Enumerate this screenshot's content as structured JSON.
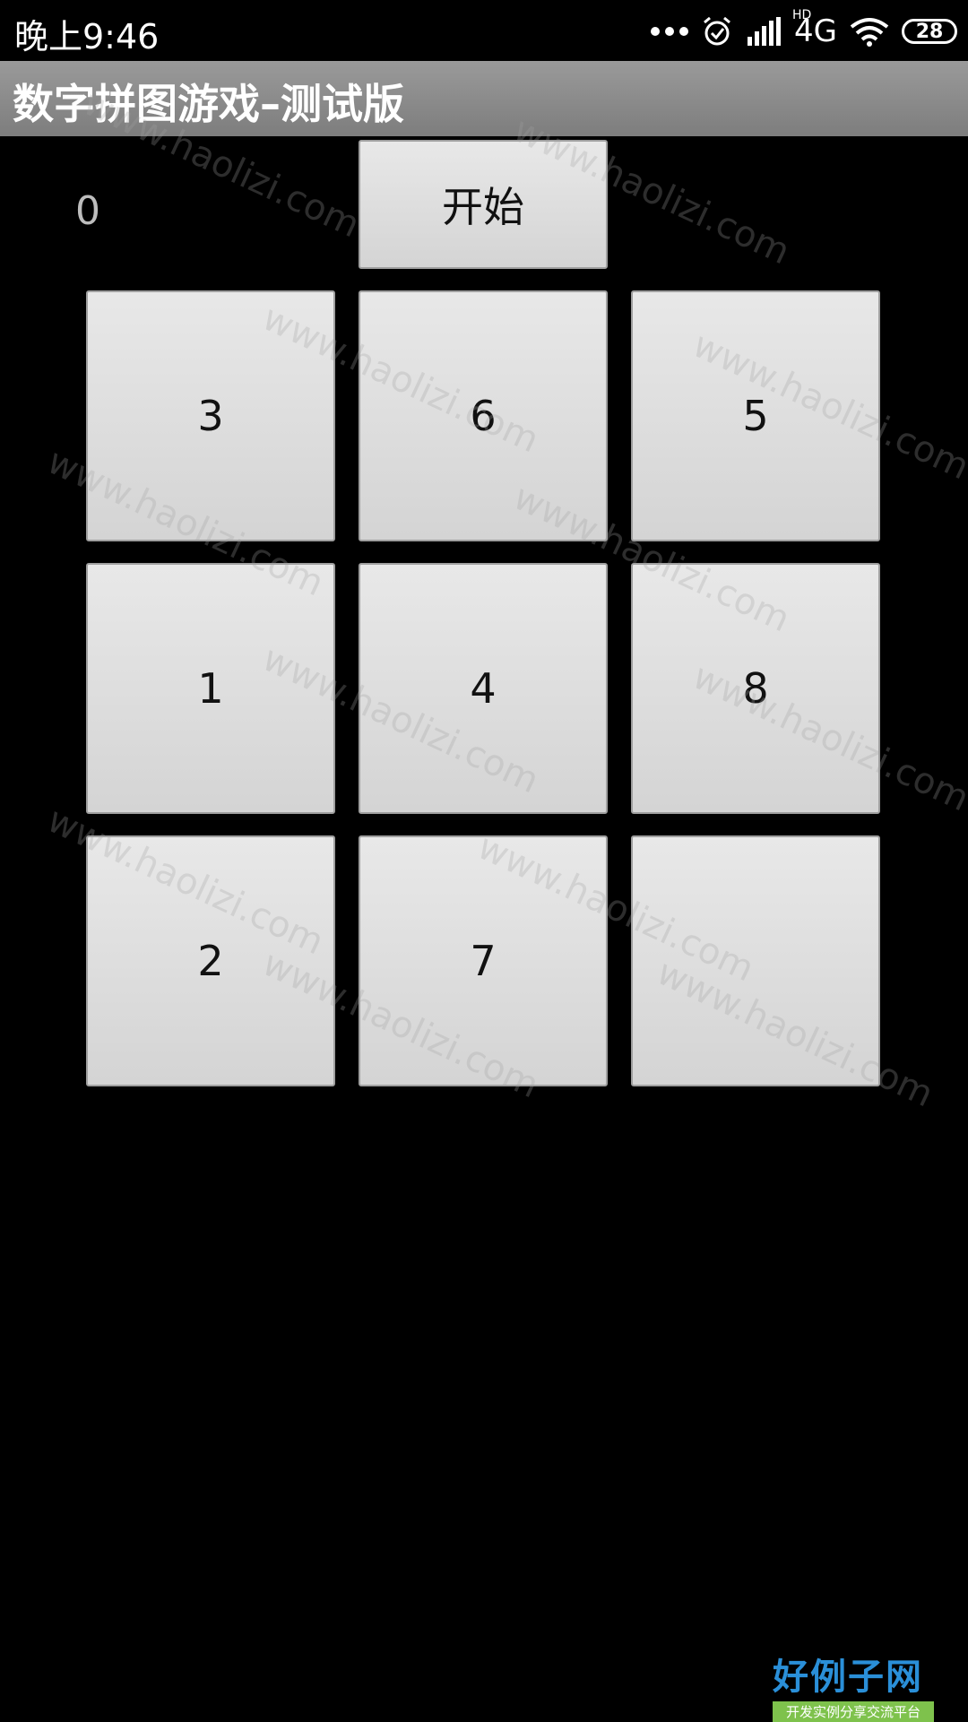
{
  "status_bar": {
    "time": "晚上9:46",
    "network": "4G",
    "network_hd": "HD",
    "battery": "28"
  },
  "app": {
    "title": "数字拼图游戏–测试版"
  },
  "game": {
    "counter": "0",
    "start_button": "开始",
    "tiles": [
      "3",
      "6",
      "5",
      "1",
      "4",
      "8",
      "2",
      "7",
      ""
    ]
  },
  "watermark": {
    "text": "www.haolizi.com"
  },
  "brand": {
    "title": "好例子网",
    "subtitle": "开发实例分享交流平台",
    "title_color": "#2a8fd8",
    "subtitle_bg": "#7ec24c"
  },
  "colors": {
    "background": "#000000",
    "title_bar": "#8a8a8a",
    "button": "#dcdcdc"
  }
}
